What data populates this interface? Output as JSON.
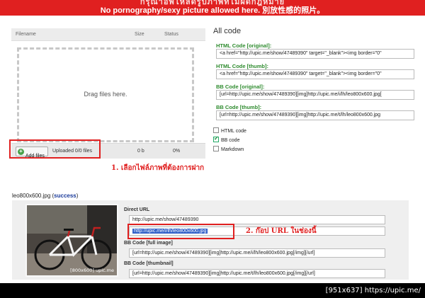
{
  "banner": {
    "line1": "กรุณาอัพโหลดรูปภาพที่ไม่ผิดกฎหมาย",
    "line2": "No pornography/sexy picture allowed here. 別放性感的照片。"
  },
  "uploader": {
    "col_filename": "Filename",
    "col_size": "Size",
    "col_status": "Status",
    "drop_text": "Drag files here.",
    "add_label": "Add files",
    "uploaded_text": "Uploaded 0/0 files",
    "total_size": "0 b",
    "total_percent": "0%"
  },
  "all_code": {
    "title": "All code",
    "fields": [
      {
        "label": "HTML Code [original]:",
        "value": "<a href=\"http://upic.me/show/47489390\" target=\"_blank\"><img border=\"0\""
      },
      {
        "label": "HTML Code [thumb]:",
        "value": "<a href=\"http://upic.me/show/47489390\" target=\"_blank\"><img border=\"0\""
      },
      {
        "label": "BB Code [original]:",
        "value": "[url=http://upic.me/show/47489390][img]http://upic.me/i/lh/leo800x600.jpg["
      },
      {
        "label": "BB Code [thumb]:",
        "value": "[url=http://upic.me/show/47489390][img]http://upic.me/t/lh/leo800x600.jpg"
      }
    ],
    "options": [
      {
        "label": "HTML code",
        "checked": false
      },
      {
        "label": "BB code",
        "checked": true
      },
      {
        "label": "Markdown",
        "checked": false
      }
    ]
  },
  "annotations": {
    "step1": "1. เลือกไฟล์ภาพที่ต้องการฝาก",
    "step2": "2. ก๊อป URL ในช่องนี้"
  },
  "result": {
    "filename": "leo800x600.jpg",
    "status": "success",
    "thumb_caption": "[800x600] upic.me",
    "direct_url_label": "Direct URL",
    "show_url": "http://upic.me/show/47489390",
    "direct_url": "http://upic.me/i/lh/leo800x600.jpg",
    "bb_full_label": "BB Code [full image]",
    "bb_full": "[url=http://upic.me/show/47489390][img]http://upic.me/i/lh/leo800x600.jpg[/img][/url]",
    "bb_thumb_label": "BB Code [thumbnail]",
    "bb_thumb": "[url=http://upic.me/show/47489390][img]http://upic.me/t/lh/leo800x600.jpg[/img][/url]"
  },
  "footer": {
    "caption": "[951x637] https://upic.me/"
  },
  "colors": {
    "banner": "#e02020",
    "annotation": "#e02020",
    "label_green": "#2e8b2e",
    "success_blue": "#1a3a9a",
    "selection": "#2f5fc8"
  }
}
